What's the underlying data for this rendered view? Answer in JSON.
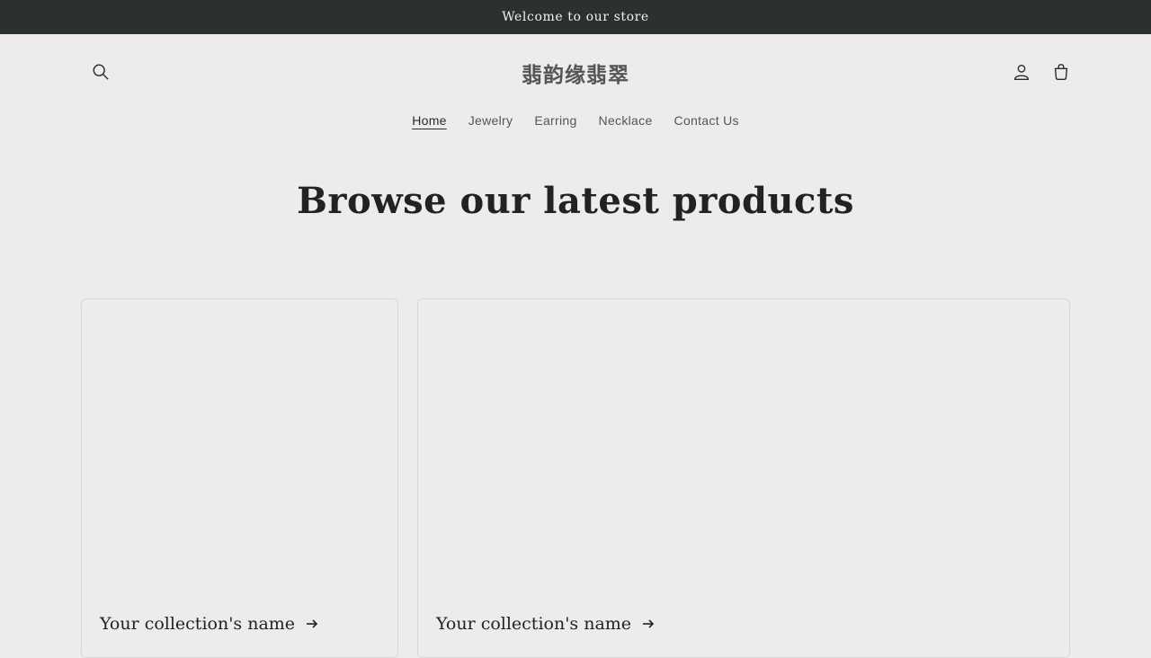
{
  "announcement": {
    "text": "Welcome to our store"
  },
  "header": {
    "logo": "翡韵缘翡翠",
    "icons": {
      "search": "search-icon",
      "account": "user-icon",
      "cart": "cart-icon"
    }
  },
  "nav": {
    "items": [
      {
        "label": "Home",
        "active": true
      },
      {
        "label": "Jewelry",
        "active": false
      },
      {
        "label": "Earring",
        "active": false
      },
      {
        "label": "Necklace",
        "active": false
      },
      {
        "label": "Contact Us",
        "active": false
      }
    ]
  },
  "main": {
    "headline": "Browse our latest products",
    "collections": [
      {
        "title": "Your collection's name"
      },
      {
        "title": "Your collection's name"
      }
    ]
  },
  "colors": {
    "announcement_bg": "#2b312e",
    "page_bg": "#edecea",
    "text": "#2a2a2a"
  }
}
